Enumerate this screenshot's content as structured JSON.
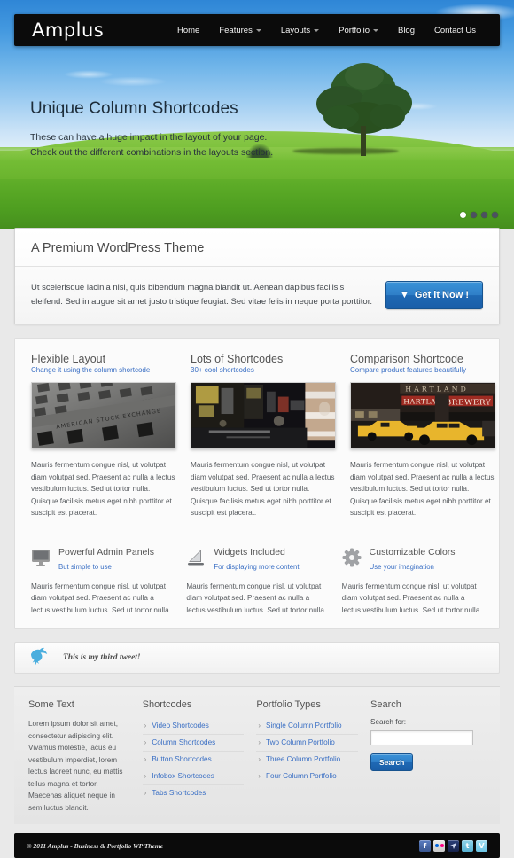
{
  "nav": {
    "logo": "Amplus",
    "items": [
      {
        "label": "Home",
        "caret": false
      },
      {
        "label": "Features",
        "caret": true
      },
      {
        "label": "Layouts",
        "caret": true
      },
      {
        "label": "Portfolio",
        "caret": true
      },
      {
        "label": "Blog",
        "caret": false
      },
      {
        "label": "Contact Us",
        "caret": false
      }
    ]
  },
  "hero": {
    "title": "Unique Column Shortcodes",
    "text": "These can have a huge impact in the layout of your page. Check out the different combinations in the layouts section.",
    "dots": 4,
    "active_dot": 1
  },
  "promo": {
    "heading": "A Premium WordPress Theme",
    "body": "Ut scelerisque lacinia nisl, quis bibendum magna blandit ut. Aenean dapibus facilisis eleifend. Sed in augue sit amet justo tristique feugiat. Sed vitae felis in neque porta porttitor.",
    "button": "Get it Now !",
    "button_icon": "double-chevron-down-icon",
    "accent": "#2f7fc8"
  },
  "features": {
    "columns": [
      {
        "title": "Flexible Layout",
        "sub": "Change it using the column shortcode",
        "image": "american-stock-exchange-building-photo",
        "body": "Mauris fermentum congue nisl, ut volutpat diam volutpat sed. Praesent ac nulla a lectus vestibulum luctus. Sed ut tortor nulla. Quisque facilisis metus eget nibh porttitor et suscipit est placerat."
      },
      {
        "title": "Lots of Shortcodes",
        "sub": "30+ cool shortcodes",
        "image": "times-square-night-street-photo",
        "body": "Mauris fermentum congue nisl, ut volutpat diam volutpat sed. Praesent ac nulla a lectus vestibulum luctus. Sed ut tortor nulla. Quisque facilisis metus eget nibh porttitor et suscipit est placerat."
      },
      {
        "title": "Comparison Shortcode",
        "sub": "Compare product features beautifully",
        "image": "yellow-taxi-heartland-brewery-photo",
        "body": "Mauris fermentum congue nisl, ut volutpat diam volutpat sed. Praesent ac nulla a lectus vestibulum luctus. Sed ut tortor nulla. Quisque facilisis metus eget nibh porttitor et suscipit est placerat."
      }
    ],
    "icon_columns": [
      {
        "icon": "monitor-icon",
        "title": "Powerful Admin Panels",
        "sub": "But simple to use",
        "body": "Mauris fermentum congue nisl, ut volutpat diam volutpat sed. Praesent ac nulla a lectus vestibulum luctus. Sed ut tortor nulla."
      },
      {
        "icon": "widget-triangle-icon",
        "title": "Widgets Included",
        "sub": "For displaying more content",
        "body": "Mauris fermentum congue nisl, ut volutpat diam volutpat sed. Praesent ac nulla a lectus vestibulum luctus. Sed ut tortor nulla."
      },
      {
        "icon": "gear-icon",
        "title": "Customizable Colors",
        "sub": "Use your imagination",
        "body": "Mauris fermentum congue nisl, ut volutpat diam volutpat sed. Praesent ac nulla a lectus vestibulum luctus. Sed ut tortor nulla."
      }
    ]
  },
  "tweet": {
    "icon": "twitter-bird-icon",
    "text": "This is my third tweet!"
  },
  "footer": {
    "some_text": {
      "title": "Some Text",
      "body": "Lorem ipsum dolor sit amet, consectetur adipiscing elit. Vivamus molestie, lacus eu vestibulum imperdiet, lorem lectus laoreet nunc, eu mattis tellus magna et tortor. Maecenas aliquet neque in sem luctus blandit."
    },
    "shortcodes": {
      "title": "Shortcodes",
      "items": [
        "Video Shortcodes",
        "Column Shortcodes",
        "Button Shortcodes",
        "Infobox Shortcodes",
        "Tabs Shortcodes"
      ]
    },
    "portfolio": {
      "title": "Portfolio Types",
      "items": [
        "Single Column Portfolio",
        "Two Column Portfolio",
        "Three Column Portfolio",
        "Four Column Portfolio"
      ]
    },
    "search": {
      "title": "Search",
      "label": "Search for:",
      "value": "",
      "placeholder": "",
      "button": "Search"
    }
  },
  "bottom": {
    "copyright": "© 2011 Amplus - Business & Portfolio WP Theme",
    "social": [
      {
        "name": "facebook-icon",
        "glyph": "f"
      },
      {
        "name": "flickr-icon",
        "glyph": ""
      },
      {
        "name": "rss-paper-icon",
        "glyph": "◤"
      },
      {
        "name": "twitter-icon",
        "glyph": "t"
      },
      {
        "name": "vimeo-icon",
        "glyph": "V"
      }
    ]
  }
}
